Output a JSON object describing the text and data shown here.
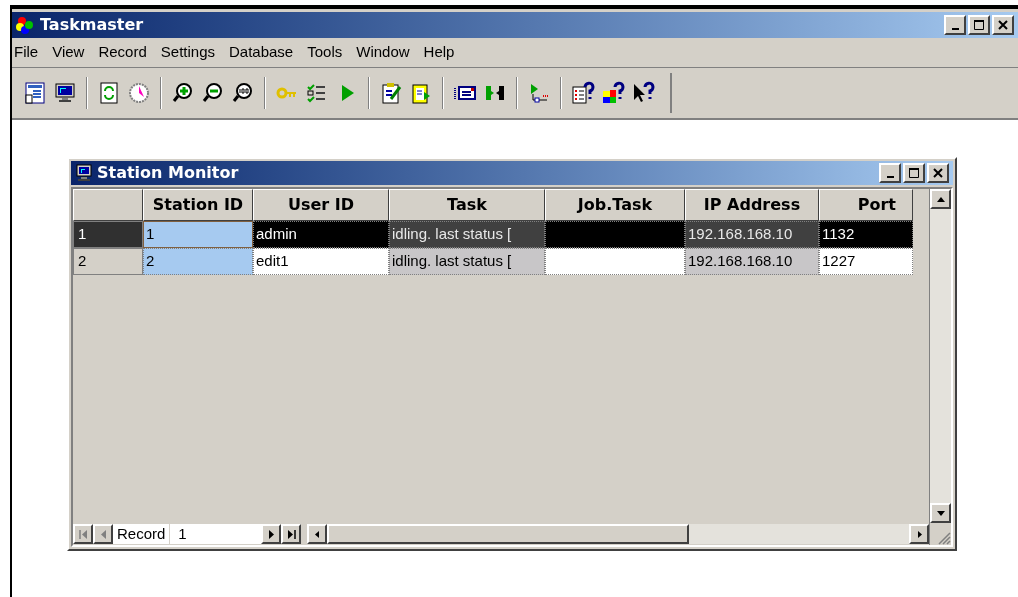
{
  "window": {
    "title": "Taskmaster"
  },
  "menu": [
    "File",
    "View",
    "Record",
    "Settings",
    "Database",
    "Tools",
    "Window",
    "Help"
  ],
  "child_window": {
    "title": "Station Monitor"
  },
  "table": {
    "columns": [
      {
        "label": "Station ID",
        "kind": "key"
      },
      {
        "label": "User ID",
        "kind": "plain"
      },
      {
        "label": "Task",
        "kind": "shaded"
      },
      {
        "label": "Job.Task",
        "kind": "plain"
      },
      {
        "label": "IP Address",
        "kind": "shaded"
      },
      {
        "label": "Port",
        "kind": "plain"
      }
    ],
    "rows": [
      {
        "header": "1",
        "selected": true,
        "cells": [
          "1",
          "admin",
          "idling. last status [",
          "",
          "192.168.168.10",
          "1132"
        ]
      },
      {
        "header": "2",
        "selected": false,
        "cells": [
          "2",
          "edit1",
          "idling. last status [",
          "",
          "192.168.168.10",
          "1227"
        ]
      }
    ]
  },
  "navigator": {
    "label": "Record",
    "value": "1"
  }
}
